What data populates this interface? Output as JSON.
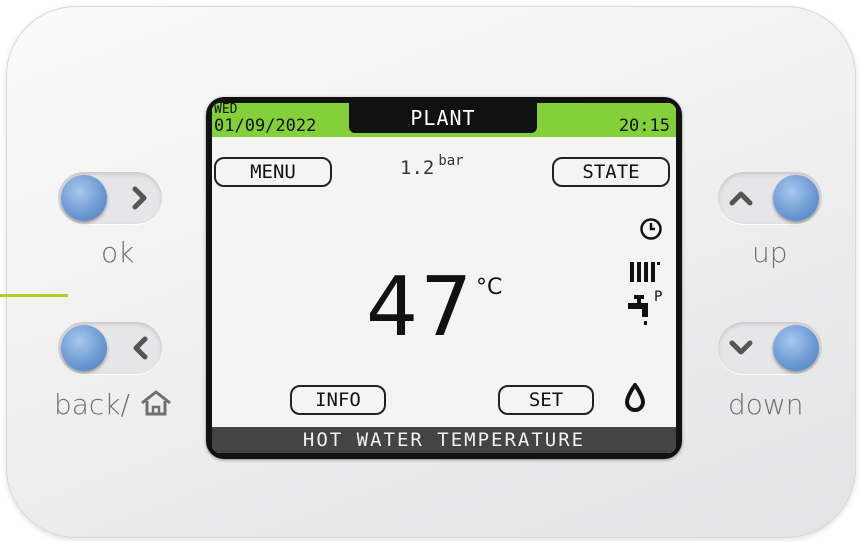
{
  "screen": {
    "day": "WED",
    "date": "01/09/2022",
    "mode_tab": "PLANT",
    "time": "20:15",
    "menu_label": "MENU",
    "pressure_value": "1.2",
    "pressure_unit": "bar",
    "state_label": "STATE",
    "temperature_value": "47",
    "temperature_unit": "°C",
    "info_label": "INFO",
    "set_label": "SET",
    "status_text": "HOT WATER TEMPERATURE",
    "icons": [
      "clock-icon",
      "radiator-icon",
      "tap-icon",
      "water-drop-icon"
    ],
    "tap_badge": "P"
  },
  "buttons": {
    "ok_label": "ok",
    "back_label": "back/",
    "up_label": "up",
    "down_label": "down"
  },
  "colors": {
    "topbar_green": "#84d03b",
    "knob_blue": "#6e9bd4",
    "status_bar": "#444444",
    "accent_line": "#b9c82c"
  }
}
